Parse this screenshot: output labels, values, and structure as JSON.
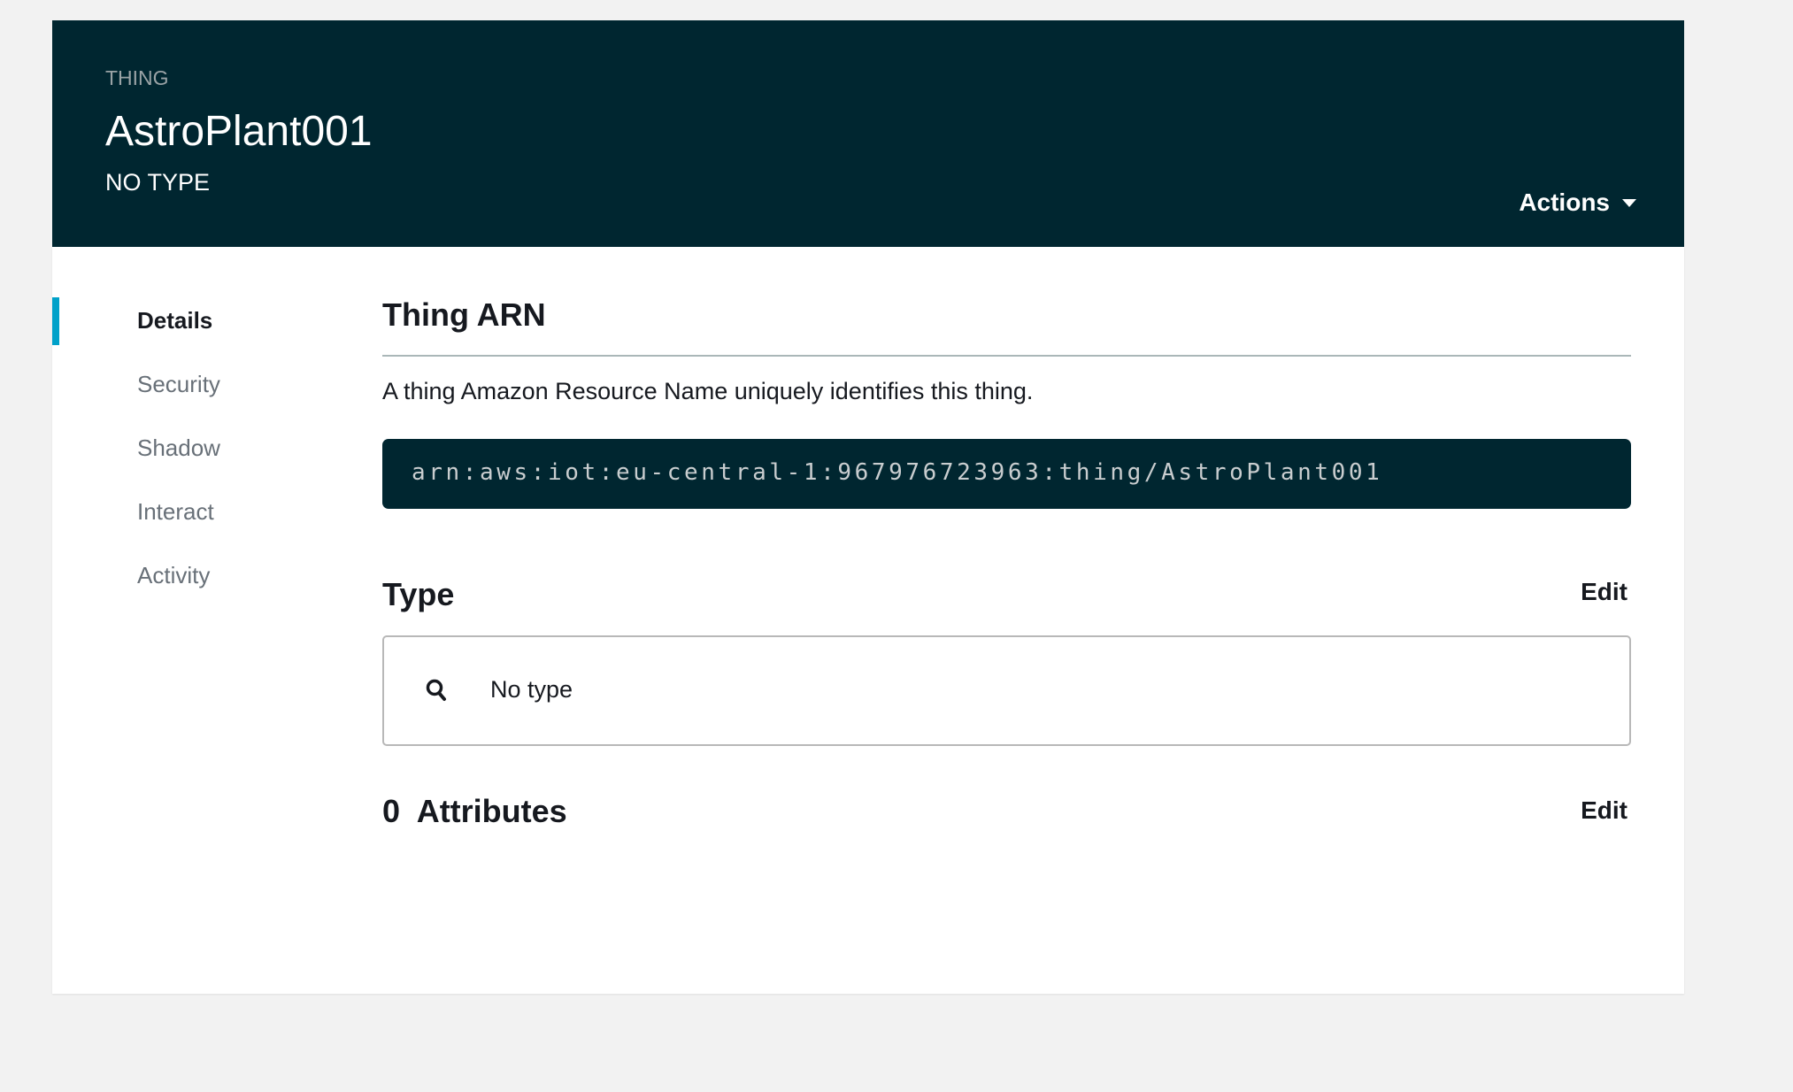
{
  "header": {
    "kicker": "THING",
    "title": "AstroPlant001",
    "subtitle": "NO TYPE",
    "actions_label": "Actions"
  },
  "nav": {
    "items": [
      {
        "label": "Details",
        "active": true
      },
      {
        "label": "Security"
      },
      {
        "label": "Shadow"
      },
      {
        "label": "Interact"
      },
      {
        "label": "Activity"
      }
    ]
  },
  "arn": {
    "heading": "Thing ARN",
    "description": "A thing Amazon Resource Name uniquely identifies this thing.",
    "value": "arn:aws:iot:eu-central-1:967976723963:thing/AstroPlant001"
  },
  "type": {
    "heading": "Type",
    "edit_label": "Edit",
    "value": "No type",
    "icon": "search-icon"
  },
  "attributes": {
    "heading": "0  Attributes",
    "edit_label": "Edit"
  },
  "colors": {
    "header_bg": "#002630",
    "accent": "#00a1c9"
  }
}
